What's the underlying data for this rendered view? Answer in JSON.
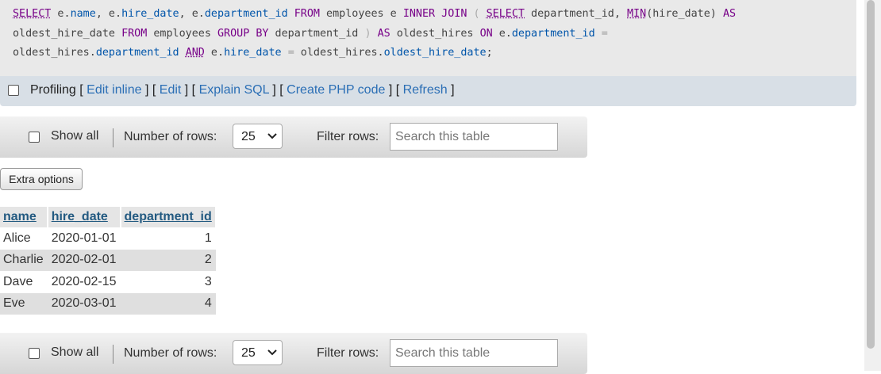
{
  "sql": {
    "line1": [
      {
        "t": "SELECT",
        "c": "kw-link"
      },
      {
        "t": " e.",
        "c": ""
      },
      {
        "t": "name",
        "c": "prop"
      },
      {
        "t": ", e.",
        "c": ""
      },
      {
        "t": "hire_date",
        "c": "prop"
      },
      {
        "t": ", e.",
        "c": ""
      },
      {
        "t": "department_id",
        "c": "prop"
      },
      {
        "t": " ",
        "c": ""
      },
      {
        "t": "FROM",
        "c": "kw"
      },
      {
        "t": " employees e ",
        "c": ""
      },
      {
        "t": "INNER JOIN",
        "c": "kw"
      },
      {
        "t": " ",
        "c": ""
      },
      {
        "t": "(",
        "c": "paren"
      },
      {
        "t": " ",
        "c": ""
      },
      {
        "t": "SELECT",
        "c": "kw-link"
      },
      {
        "t": " department_id, ",
        "c": ""
      },
      {
        "t": "MIN",
        "c": "fn"
      },
      {
        "t": "(hire_date) ",
        "c": ""
      },
      {
        "t": "AS",
        "c": "kw"
      }
    ],
    "line2": [
      {
        "t": "oldest_hire_date ",
        "c": ""
      },
      {
        "t": "FROM",
        "c": "kw"
      },
      {
        "t": " employees ",
        "c": ""
      },
      {
        "t": "GROUP BY",
        "c": "kw"
      },
      {
        "t": " department_id ",
        "c": ""
      },
      {
        "t": ")",
        "c": "paren"
      },
      {
        "t": " ",
        "c": ""
      },
      {
        "t": "AS",
        "c": "kw"
      },
      {
        "t": " oldest_hires ",
        "c": ""
      },
      {
        "t": "ON",
        "c": "kw"
      },
      {
        "t": " e.",
        "c": ""
      },
      {
        "t": "department_id",
        "c": "prop"
      },
      {
        "t": " ",
        "c": ""
      },
      {
        "t": "=",
        "c": "op"
      }
    ],
    "line3": [
      {
        "t": "oldest_hires.",
        "c": ""
      },
      {
        "t": "department_id",
        "c": "prop"
      },
      {
        "t": " ",
        "c": ""
      },
      {
        "t": "AND",
        "c": "kw-link"
      },
      {
        "t": " e.",
        "c": ""
      },
      {
        "t": "hire_date",
        "c": "prop"
      },
      {
        "t": " ",
        "c": ""
      },
      {
        "t": "=",
        "c": "op"
      },
      {
        "t": " oldest_hires.",
        "c": ""
      },
      {
        "t": "oldest_hire_date",
        "c": "prop"
      },
      {
        "t": ";",
        "c": ""
      }
    ]
  },
  "profiling": {
    "label": "Profiling",
    "links": [
      "Edit inline",
      "Edit",
      "Explain SQL",
      "Create PHP code",
      "Refresh"
    ]
  },
  "nav": {
    "show_all": "Show all",
    "number_of_rows_label": "Number of rows:",
    "rows_value": "25",
    "filter_label": "Filter rows:",
    "search_placeholder": "Search this table"
  },
  "extra_options": "Extra options",
  "table": {
    "columns": [
      "name",
      "hire_date",
      "department_id"
    ],
    "rows": [
      [
        "Alice",
        "2020-01-01",
        "1"
      ],
      [
        "Charlie",
        "2020-02-01",
        "2"
      ],
      [
        "Dave",
        "2020-02-15",
        "3"
      ],
      [
        "Eve",
        "2020-03-01",
        "4"
      ]
    ]
  },
  "colors": {
    "keyword": "#770088",
    "property": "#0055aa",
    "link": "#2a6eb5",
    "header_text": "#235a81"
  }
}
